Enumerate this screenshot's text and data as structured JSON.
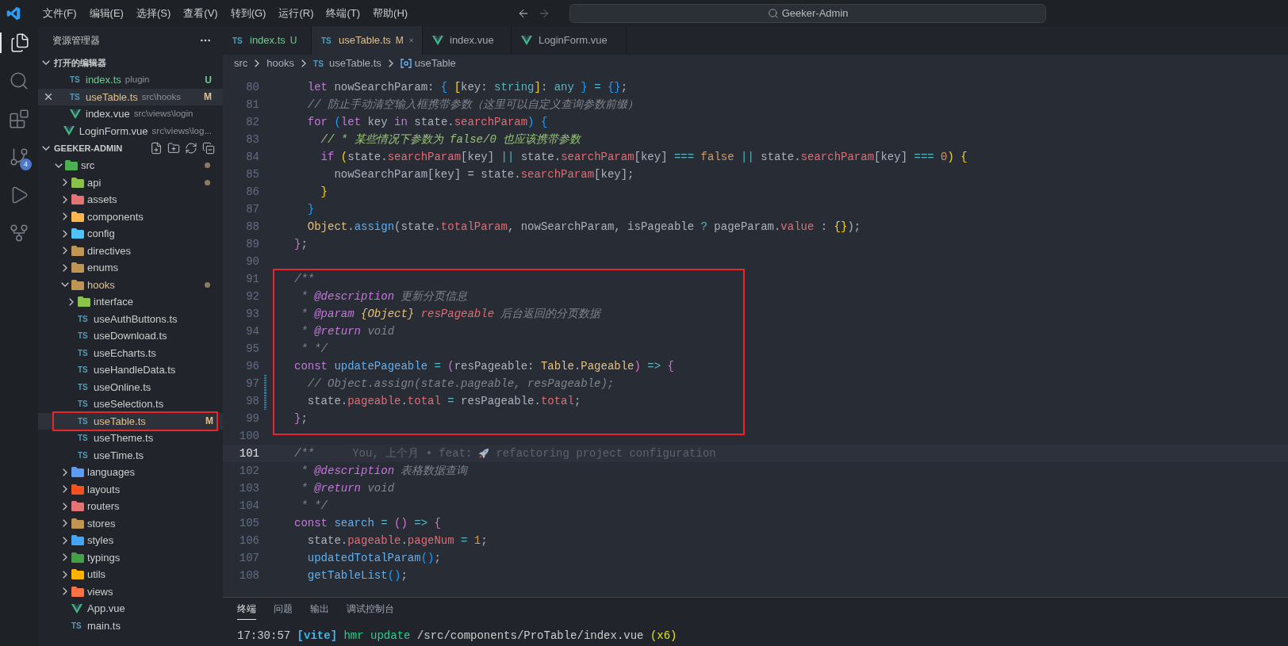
{
  "menu": [
    "文件(F)",
    "编辑(E)",
    "选择(S)",
    "查看(V)",
    "转到(G)",
    "运行(R)",
    "终端(T)",
    "帮助(H)"
  ],
  "search": {
    "value": "Geeker-Admin"
  },
  "activity_bar": [
    {
      "kind": "explorer",
      "selected": true
    },
    {
      "kind": "search",
      "selected": false
    },
    {
      "kind": "extensions",
      "selected": false
    },
    {
      "kind": "source-control",
      "selected": false,
      "badge": "4"
    },
    {
      "kind": "run",
      "selected": false
    },
    {
      "kind": "git-graph",
      "selected": false
    }
  ],
  "sidebar": {
    "title": "资源管理器",
    "open_editors": {
      "title": "打开的编辑器",
      "items": [
        {
          "name": "index.ts",
          "path": "plugin",
          "kind": "ts",
          "icon_label": "TS",
          "untracked": true,
          "modified": false,
          "badge": "U",
          "selected": false
        },
        {
          "name": "useTable.ts",
          "path": "src\\hooks",
          "kind": "ts",
          "icon_label": "TS",
          "untracked": false,
          "modified": true,
          "badge": "M",
          "selected": true
        },
        {
          "name": "index.vue",
          "path": "src\\views\\login",
          "kind": "vue",
          "untracked": false,
          "modified": false,
          "selected": false
        },
        {
          "name": "LoginForm.vue",
          "path": "src\\views\\log...",
          "kind": "vue",
          "untracked": false,
          "modified": false,
          "selected": false
        }
      ]
    },
    "project": {
      "title": "GEEKER-ADMIN",
      "tree": [
        {
          "name": "src",
          "kind": "folder",
          "color": "#4caf50",
          "modified": false,
          "dot": true,
          "expanded": true,
          "selected": false,
          "outlined": false,
          "children": [
            {
              "name": "api",
              "kind": "folder",
              "color": "#8bc34a",
              "modified": false,
              "dot": true,
              "expanded": false,
              "selected": false,
              "outlined": false
            },
            {
              "name": "assets",
              "kind": "folder",
              "color": "#e57373",
              "modified": false,
              "dot": false,
              "expanded": false,
              "selected": false,
              "outlined": false
            },
            {
              "name": "components",
              "kind": "folder",
              "color": "#ffb74d",
              "modified": false,
              "dot": false,
              "expanded": false,
              "selected": false,
              "outlined": false
            },
            {
              "name": "config",
              "kind": "folder",
              "color": "#4fc3f7",
              "modified": false,
              "dot": false,
              "expanded": false,
              "selected": false,
              "outlined": false
            },
            {
              "name": "directives",
              "kind": "folder",
              "color": "#c09553",
              "modified": false,
              "dot": false,
              "expanded": false,
              "selected": false,
              "outlined": false
            },
            {
              "name": "enums",
              "kind": "folder",
              "color": "#c09553",
              "modified": false,
              "dot": false,
              "expanded": false,
              "selected": false,
              "outlined": false
            },
            {
              "name": "hooks",
              "kind": "folder",
              "color": "#c09553",
              "modified": true,
              "dot": true,
              "expanded": true,
              "selected": false,
              "outlined": false,
              "children": [
                {
                  "name": "interface",
                  "kind": "folder",
                  "color": "#8bc34a",
                  "modified": false,
                  "dot": false,
                  "expanded": false,
                  "selected": false,
                  "outlined": false
                },
                {
                  "name": "useAuthButtons.ts",
                  "kind": "ts",
                  "icon_label": "TS",
                  "modified": false,
                  "dot": false,
                  "selected": false,
                  "outlined": false
                },
                {
                  "name": "useDownload.ts",
                  "kind": "ts",
                  "icon_label": "TS",
                  "modified": false,
                  "dot": false,
                  "selected": false,
                  "outlined": false
                },
                {
                  "name": "useEcharts.ts",
                  "kind": "ts",
                  "icon_label": "TS",
                  "modified": false,
                  "dot": false,
                  "selected": false,
                  "outlined": false
                },
                {
                  "name": "useHandleData.ts",
                  "kind": "ts",
                  "icon_label": "TS",
                  "modified": false,
                  "dot": false,
                  "selected": false,
                  "outlined": false
                },
                {
                  "name": "useOnline.ts",
                  "kind": "ts",
                  "icon_label": "TS",
                  "modified": false,
                  "dot": false,
                  "selected": false,
                  "outlined": false
                },
                {
                  "name": "useSelection.ts",
                  "kind": "ts",
                  "icon_label": "TS",
                  "modified": false,
                  "dot": false,
                  "selected": false,
                  "outlined": false
                },
                {
                  "name": "useTable.ts",
                  "kind": "ts",
                  "icon_label": "TS",
                  "modified": true,
                  "badge": "M",
                  "dot": false,
                  "selected": true,
                  "outlined": true
                },
                {
                  "name": "useTheme.ts",
                  "kind": "ts",
                  "icon_label": "TS",
                  "modified": false,
                  "dot": false,
                  "selected": false,
                  "outlined": false
                },
                {
                  "name": "useTime.ts",
                  "kind": "ts",
                  "icon_label": "TS",
                  "modified": false,
                  "dot": false,
                  "selected": false,
                  "outlined": false
                }
              ]
            },
            {
              "name": "languages",
              "kind": "folder",
              "color": "#5c9cf5",
              "modified": false,
              "dot": false,
              "expanded": false,
              "selected": false,
              "outlined": false
            },
            {
              "name": "layouts",
              "kind": "folder",
              "color": "#f4511e",
              "modified": false,
              "dot": false,
              "expanded": false,
              "selected": false,
              "outlined": false
            },
            {
              "name": "routers",
              "kind": "folder",
              "color": "#e57373",
              "modified": false,
              "dot": false,
              "expanded": false,
              "selected": false,
              "outlined": false
            },
            {
              "name": "stores",
              "kind": "folder",
              "color": "#c09553",
              "modified": false,
              "dot": false,
              "expanded": false,
              "selected": false,
              "outlined": false
            },
            {
              "name": "styles",
              "kind": "folder",
              "color": "#42a5f5",
              "modified": false,
              "dot": false,
              "expanded": false,
              "selected": false,
              "outlined": false
            },
            {
              "name": "typings",
              "kind": "folder",
              "color": "#43a047",
              "modified": false,
              "dot": false,
              "expanded": false,
              "selected": false,
              "outlined": false
            },
            {
              "name": "utils",
              "kind": "folder",
              "color": "#ffb300",
              "modified": false,
              "dot": false,
              "expanded": false,
              "selected": false,
              "outlined": false
            },
            {
              "name": "views",
              "kind": "folder",
              "color": "#ff7043",
              "modified": false,
              "dot": false,
              "expanded": false,
              "selected": false,
              "outlined": false
            },
            {
              "name": "App.vue",
              "kind": "vue",
              "modified": false,
              "dot": false,
              "selected": false,
              "outlined": false
            },
            {
              "name": "main.ts",
              "kind": "ts",
              "icon_label": "TS",
              "modified": false,
              "dot": false,
              "selected": false,
              "outlined": false
            }
          ]
        }
      ]
    }
  },
  "tabs": [
    {
      "label": "index.ts",
      "kind": "ts",
      "icon_label": "TS",
      "untracked": true,
      "modified": false,
      "badge": "U",
      "selected": false
    },
    {
      "label": "useTable.ts",
      "kind": "ts",
      "icon_label": "TS",
      "untracked": false,
      "modified": true,
      "badge": "M",
      "selected": true
    },
    {
      "label": "index.vue",
      "kind": "vue",
      "untracked": false,
      "modified": false,
      "selected": false
    },
    {
      "label": "LoginForm.vue",
      "kind": "vue",
      "untracked": false,
      "modified": false,
      "selected": false
    }
  ],
  "breadcrumb": [
    {
      "label": "src",
      "kind": "folder"
    },
    {
      "label": "hooks",
      "kind": "folder"
    },
    {
      "label": "useTable.ts",
      "kind": "ts",
      "icon_label": "TS"
    },
    {
      "label": "useTable",
      "kind": "symbol"
    }
  ],
  "editor": {
    "lines": [
      {
        "number": "80",
        "current": false,
        "changed": false,
        "outlined": false,
        "tokens": [
          {
            "kind": "keyword",
            "text": "  let"
          },
          {
            "kind": "plain",
            "text": " nowSearchParam: "
          },
          {
            "kind": "bracket-2",
            "text": "{"
          },
          {
            "kind": "bracket-3",
            "text": " ["
          },
          {
            "kind": "plain",
            "text": "key: "
          },
          {
            "kind": "type",
            "text": "string"
          },
          {
            "kind": "bracket-3",
            "text": "]"
          },
          {
            "kind": "plain",
            "text": ": "
          },
          {
            "kind": "type",
            "text": "any"
          },
          {
            "kind": "bracket-2",
            "text": " }"
          },
          {
            "kind": "operator",
            "text": " ="
          },
          {
            "kind": "bracket-2",
            "text": " {}"
          },
          {
            "kind": "plain",
            "text": ";"
          }
        ]
      },
      {
        "number": "81",
        "current": false,
        "changed": false,
        "outlined": false,
        "tokens": [
          {
            "kind": "comment",
            "text": "  // 防止手动清空输入框携带参数（这里可以自定义查询参数前缀）"
          }
        ]
      },
      {
        "number": "82",
        "current": false,
        "changed": false,
        "outlined": false,
        "tokens": [
          {
            "kind": "keyword",
            "text": "  for"
          },
          {
            "kind": "bracket-2",
            "text": " ("
          },
          {
            "kind": "keyword",
            "text": "let"
          },
          {
            "kind": "plain",
            "text": " key "
          },
          {
            "kind": "keyword",
            "text": "in"
          },
          {
            "kind": "plain",
            "text": " state."
          },
          {
            "kind": "property",
            "text": "searchParam"
          },
          {
            "kind": "bracket-2",
            "text": ")"
          },
          {
            "kind": "bracket-2",
            "text": " {"
          }
        ]
      },
      {
        "number": "83",
        "current": false,
        "changed": false,
        "outlined": false,
        "tokens": [
          {
            "kind": "comment-green",
            "text": "    // * 某些情况下参数为 false/0 也应该携带参数"
          }
        ]
      },
      {
        "number": "84",
        "current": false,
        "changed": false,
        "outlined": false,
        "tokens": [
          {
            "kind": "keyword",
            "text": "    if"
          },
          {
            "kind": "bracket-3",
            "text": " ("
          },
          {
            "kind": "plain",
            "text": "state."
          },
          {
            "kind": "property",
            "text": "searchParam"
          },
          {
            "kind": "plain",
            "text": "[key] "
          },
          {
            "kind": "operator",
            "text": "||"
          },
          {
            "kind": "plain",
            "text": " state."
          },
          {
            "kind": "property",
            "text": "searchParam"
          },
          {
            "kind": "plain",
            "text": "[key] "
          },
          {
            "kind": "operator",
            "text": "==="
          },
          {
            "kind": "number",
            "text": " false"
          },
          {
            "kind": "operator",
            "text": " ||"
          },
          {
            "kind": "plain",
            "text": " state."
          },
          {
            "kind": "property",
            "text": "searchParam"
          },
          {
            "kind": "plain",
            "text": "[key] "
          },
          {
            "kind": "operator",
            "text": "==="
          },
          {
            "kind": "number",
            "text": " 0"
          },
          {
            "kind": "bracket-3",
            "text": ")"
          },
          {
            "kind": "bracket-3",
            "text": " {"
          }
        ]
      },
      {
        "number": "85",
        "current": false,
        "changed": false,
        "outlined": false,
        "tokens": [
          {
            "kind": "plain",
            "text": "      nowSearchParam[key] = state."
          },
          {
            "kind": "property",
            "text": "searchParam"
          },
          {
            "kind": "plain",
            "text": "[key];"
          }
        ]
      },
      {
        "number": "86",
        "current": false,
        "changed": false,
        "outlined": false,
        "tokens": [
          {
            "kind": "bracket-3",
            "text": "    }"
          }
        ]
      },
      {
        "number": "87",
        "current": false,
        "changed": false,
        "outlined": false,
        "tokens": [
          {
            "kind": "bracket-2",
            "text": "  }"
          }
        ]
      },
      {
        "number": "88",
        "current": false,
        "changed": false,
        "outlined": false,
        "tokens": [
          {
            "kind": "class",
            "text": "  Object"
          },
          {
            "kind": "plain",
            "text": "."
          },
          {
            "kind": "function",
            "text": "assign"
          },
          {
            "kind": "plain",
            "text": "(state."
          },
          {
            "kind": "property",
            "text": "totalParam"
          },
          {
            "kind": "plain",
            "text": ", nowSearchParam, isPageable "
          },
          {
            "kind": "operator",
            "text": "?"
          },
          {
            "kind": "plain",
            "text": " pageParam."
          },
          {
            "kind": "property",
            "text": "value"
          },
          {
            "kind": "plain",
            "text": " : "
          },
          {
            "kind": "bracket-3",
            "text": "{}"
          },
          {
            "kind": "plain",
            "text": ");"
          }
        ]
      },
      {
        "number": "89",
        "current": false,
        "changed": false,
        "outlined": false,
        "tokens": [
          {
            "kind": "bracket-1",
            "text": "}"
          },
          {
            "kind": "plain",
            "text": ";"
          }
        ]
      },
      {
        "number": "90",
        "current": false,
        "changed": false,
        "outlined": false
      },
      {
        "number": "91",
        "current": false,
        "changed": false,
        "outlined": true,
        "tokens": [
          {
            "kind": "comment",
            "text": "/**"
          }
        ]
      },
      {
        "number": "92",
        "current": false,
        "changed": false,
        "outlined": true,
        "tokens": [
          {
            "kind": "comment",
            "text": " *"
          },
          {
            "kind": "doc-tag",
            "text": " @description"
          },
          {
            "kind": "comment",
            "text": " 更新分页信息"
          }
        ]
      },
      {
        "number": "93",
        "current": false,
        "changed": false,
        "outlined": true,
        "tokens": [
          {
            "kind": "comment",
            "text": " *"
          },
          {
            "kind": "doc-tag",
            "text": " @param"
          },
          {
            "kind": "doc-type",
            "text": " {Object}"
          },
          {
            "kind": "doc-param",
            "text": " resPageable"
          },
          {
            "kind": "comment",
            "text": " 后台返回的分页数据"
          }
        ]
      },
      {
        "number": "94",
        "current": false,
        "changed": false,
        "outlined": true,
        "tokens": [
          {
            "kind": "comment",
            "text": " *"
          },
          {
            "kind": "doc-tag",
            "text": " @return"
          },
          {
            "kind": "comment",
            "text": " void"
          }
        ]
      },
      {
        "number": "95",
        "current": false,
        "changed": false,
        "outlined": true,
        "tokens": [
          {
            "kind": "comment",
            "text": " * */"
          }
        ]
      },
      {
        "number": "96",
        "current": false,
        "changed": false,
        "outlined": true,
        "tokens": [
          {
            "kind": "keyword",
            "text": "const"
          },
          {
            "kind": "function",
            "text": " updatePageable"
          },
          {
            "kind": "operator",
            "text": " ="
          },
          {
            "kind": "bracket-1",
            "text": " ("
          },
          {
            "kind": "plain",
            "text": "resPageable: "
          },
          {
            "kind": "class",
            "text": "Table"
          },
          {
            "kind": "plain",
            "text": "."
          },
          {
            "kind": "class",
            "text": "Pageable"
          },
          {
            "kind": "bracket-1",
            "text": ")"
          },
          {
            "kind": "operator",
            "text": " =>"
          },
          {
            "kind": "bracket-1",
            "text": " {"
          }
        ]
      },
      {
        "number": "97",
        "current": false,
        "changed": true,
        "outlined": true,
        "tokens": [
          {
            "kind": "comment",
            "text": "  // Object.assign(state.pageable, resPageable);"
          }
        ]
      },
      {
        "number": "98",
        "current": false,
        "changed": true,
        "outlined": true,
        "tokens": [
          {
            "kind": "plain",
            "text": "  state."
          },
          {
            "kind": "property",
            "text": "pageable"
          },
          {
            "kind": "plain",
            "text": "."
          },
          {
            "kind": "property",
            "text": "total"
          },
          {
            "kind": "operator",
            "text": " ="
          },
          {
            "kind": "plain",
            "text": " resPageable."
          },
          {
            "kind": "property",
            "text": "total"
          },
          {
            "kind": "plain",
            "text": ";"
          }
        ]
      },
      {
        "number": "99",
        "current": false,
        "changed": false,
        "outlined": true,
        "tokens": [
          {
            "kind": "bracket-1",
            "text": "}"
          },
          {
            "kind": "plain",
            "text": ";"
          }
        ]
      },
      {
        "number": "100",
        "current": false,
        "changed": false,
        "outlined": false
      },
      {
        "number": "101",
        "current": true,
        "changed": false,
        "outlined": false,
        "tokens": [
          {
            "kind": "comment",
            "text": "/**"
          }
        ],
        "blame": {
          "before": "You, 上个月 • feat:",
          "after": "refactoring project configuration"
        }
      },
      {
        "number": "102",
        "current": false,
        "changed": false,
        "outlined": false,
        "tokens": [
          {
            "kind": "comment",
            "text": " *"
          },
          {
            "kind": "doc-tag",
            "text": " @description"
          },
          {
            "kind": "comment",
            "text": " 表格数据查询"
          }
        ]
      },
      {
        "number": "103",
        "current": false,
        "changed": false,
        "outlined": false,
        "tokens": [
          {
            "kind": "comment",
            "text": " *"
          },
          {
            "kind": "doc-tag",
            "text": " @return"
          },
          {
            "kind": "comment",
            "text": " void"
          }
        ]
      },
      {
        "number": "104",
        "current": false,
        "changed": false,
        "outlined": false,
        "tokens": [
          {
            "kind": "comment",
            "text": " * */"
          }
        ]
      },
      {
        "number": "105",
        "current": false,
        "changed": false,
        "outlined": false,
        "tokens": [
          {
            "kind": "keyword",
            "text": "const"
          },
          {
            "kind": "function",
            "text": " search"
          },
          {
            "kind": "operator",
            "text": " ="
          },
          {
            "kind": "bracket-1",
            "text": " ()"
          },
          {
            "kind": "operator",
            "text": " =>"
          },
          {
            "kind": "bracket-1",
            "text": " {"
          }
        ]
      },
      {
        "number": "106",
        "current": false,
        "changed": false,
        "outlined": false,
        "tokens": [
          {
            "kind": "plain",
            "text": "  state."
          },
          {
            "kind": "property",
            "text": "pageable"
          },
          {
            "kind": "plain",
            "text": "."
          },
          {
            "kind": "property",
            "text": "pageNum"
          },
          {
            "kind": "operator",
            "text": " ="
          },
          {
            "kind": "number",
            "text": " 1"
          },
          {
            "kind": "plain",
            "text": ";"
          }
        ]
      },
      {
        "number": "107",
        "current": false,
        "changed": false,
        "outlined": false,
        "tokens": [
          {
            "kind": "function",
            "text": "  updatedTotalParam"
          },
          {
            "kind": "bracket-2",
            "text": "()"
          },
          {
            "kind": "plain",
            "text": ";"
          }
        ]
      },
      {
        "number": "108",
        "current": false,
        "changed": false,
        "outlined": false,
        "tokens": [
          {
            "kind": "function",
            "text": "  getTableList"
          },
          {
            "kind": "bracket-2",
            "text": "()"
          },
          {
            "kind": "plain",
            "text": ";"
          }
        ]
      }
    ]
  },
  "panel": {
    "tabs": [
      {
        "label": "终端",
        "selected": true
      },
      {
        "label": "问题",
        "selected": false
      },
      {
        "label": "输出",
        "selected": false
      },
      {
        "label": "调试控制台",
        "selected": false
      }
    ],
    "terminal_lines": [
      [
        {
          "kind": "time",
          "text": "17:30:57"
        },
        {
          "kind": "tag",
          "text": " [vite]"
        },
        {
          "kind": "action",
          "text": " hmr update"
        },
        {
          "kind": "plain",
          "text": " /src/components/ProTable/index.vue"
        },
        {
          "kind": "count",
          "text": " (x6)"
        }
      ]
    ]
  }
}
